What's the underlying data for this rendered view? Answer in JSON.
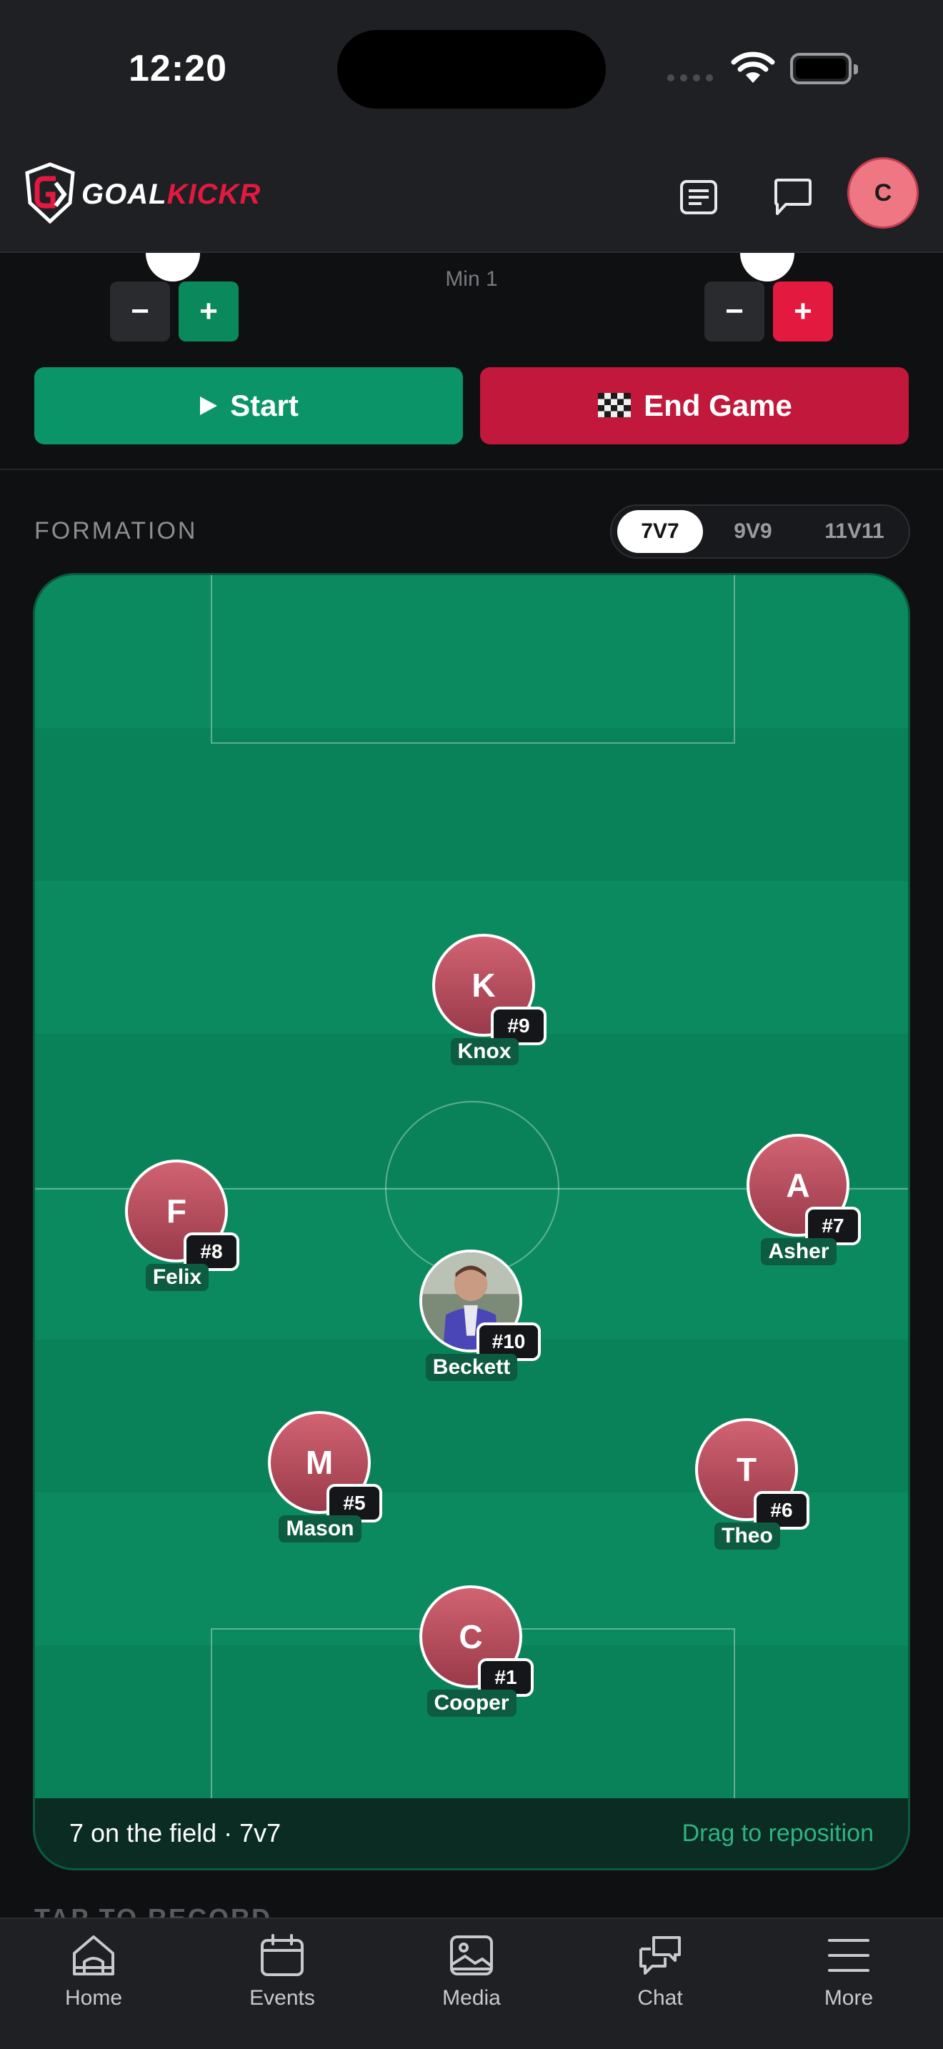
{
  "status_bar": {
    "time": "12:20"
  },
  "header": {
    "brand_part1": "GOAL",
    "brand_part2": "KICKR",
    "avatar_initial": "C"
  },
  "score": {
    "minute": "Min 1",
    "minus": "−",
    "plus": "+"
  },
  "actions": {
    "start_label": "Start",
    "end_label": "End Game"
  },
  "formation": {
    "label": "FORMATION",
    "options": [
      "7V7",
      "9V9",
      "11V11"
    ],
    "selected": "7V7"
  },
  "players": [
    {
      "initial": "K",
      "number": "#9",
      "name": "Knox"
    },
    {
      "initial": "F",
      "number": "#8",
      "name": "Felix"
    },
    {
      "initial": "A",
      "number": "#7",
      "name": "Asher"
    },
    {
      "initial": "",
      "number": "#10",
      "name": "Beckett"
    },
    {
      "initial": "M",
      "number": "#5",
      "name": "Mason"
    },
    {
      "initial": "T",
      "number": "#6",
      "name": "Theo"
    },
    {
      "initial": "C",
      "number": "#1",
      "name": "Cooper"
    }
  ],
  "pitch_footer": {
    "count_text": "7 on the field · 7v7",
    "hint": "Drag to reposition"
  },
  "section_peek": "TAP TO RECORD",
  "tabs": [
    {
      "label": "Home",
      "icon": "home-icon"
    },
    {
      "label": "Events",
      "icon": "calendar-icon"
    },
    {
      "label": "Media",
      "icon": "image-icon"
    },
    {
      "label": "Chat",
      "icon": "chat-icon"
    },
    {
      "label": "More",
      "icon": "menu-icon"
    }
  ],
  "colors": {
    "brand_red": "#e3193f",
    "green": "#0a9467",
    "pitch": "#0b8a5f",
    "bg": "#0f1012"
  }
}
